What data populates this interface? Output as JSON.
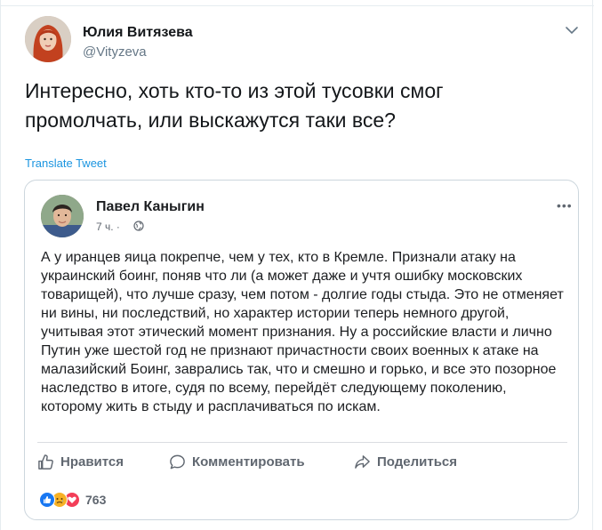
{
  "tweet": {
    "author_name": "Юлия Витязева",
    "author_handle": "@Vityzeva",
    "text": "Интересно, хоть кто-то из этой тусовки смог промолчать, или выскажутся таки все?",
    "translate_label": "Translate Tweet"
  },
  "embedded_post": {
    "author_name": "Павел Каныгин",
    "time": "7 ч. ·",
    "more_label": "•••",
    "text": "А у иранцев яица покрепче, чем у тех, кто в Кремле. Признали атаку на украинский боинг, поняв что ли (а может даже и учтя ошибку московских товарищей), что лучше сразу, чем потом - долгие годы стыда. Это не отменяет ни вины, ни последствий, но характер истории теперь немного другой, учитывая этот этический момент признания. Ну а российские власти и лично Путин уже шестой год не признают причастности своих военных к атаке на малазийский Боинг, заврались так, что и смешно и горько, и все это позорное наследство в итоге, судя по всему, перейдёт следующему поколению, которому жить в стыду и расплачиваться по искам.",
    "actions": {
      "like": "Нравится",
      "comment": "Комментировать",
      "share": "Поделиться"
    },
    "reaction_count": "763"
  },
  "colors": {
    "link_blue": "#1b95e0",
    "fb_grey": "#606770",
    "like_blue": "#1877f2",
    "love_red": "#f33e58",
    "sad_yellow": "#f7b125"
  }
}
